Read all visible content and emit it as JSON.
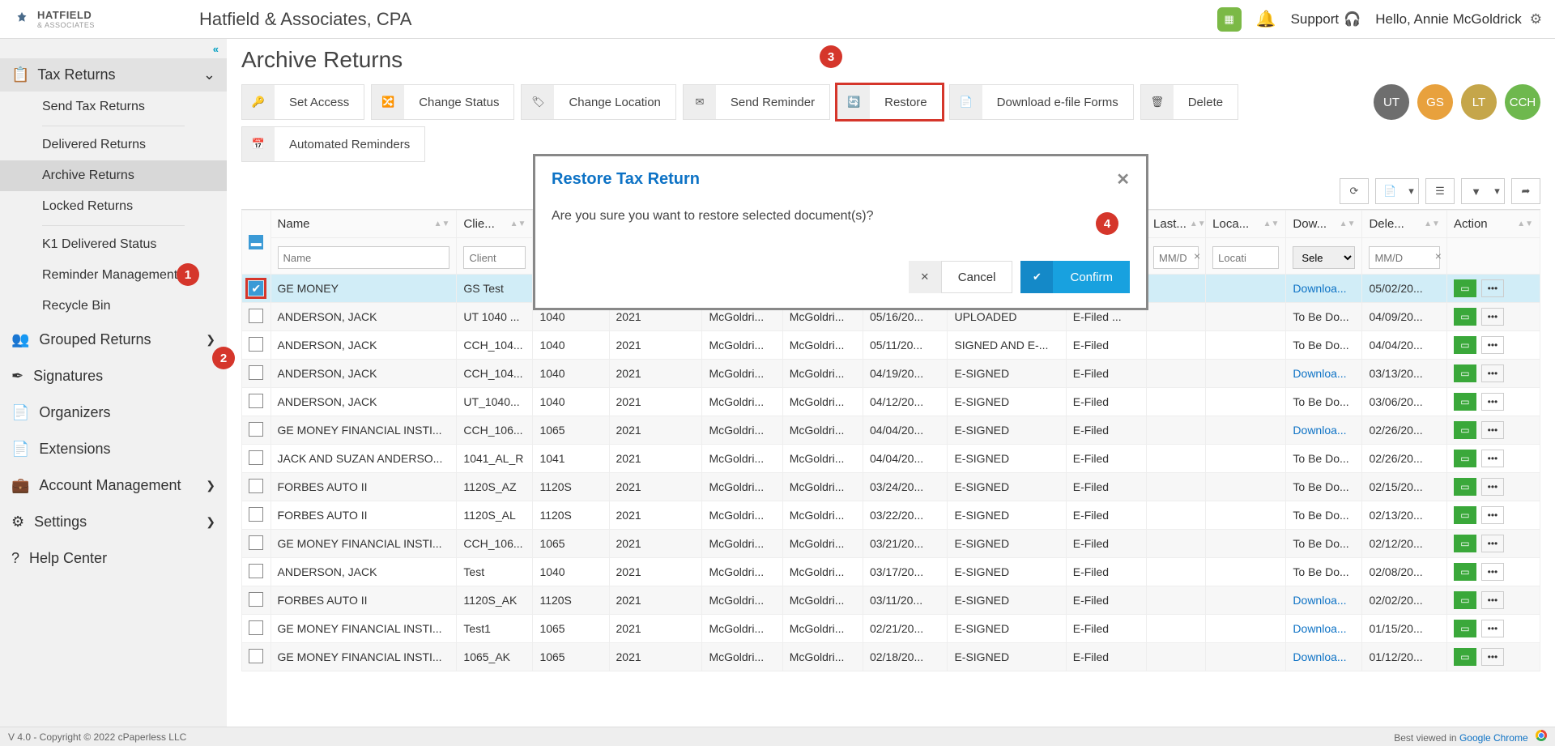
{
  "header": {
    "logo_main": "HATFIELD",
    "logo_sub": "& ASSOCIATES",
    "company": "Hatfield & Associates, CPA",
    "support": "Support",
    "hello": "Hello, Annie McGoldrick"
  },
  "sidebar": {
    "top": "Tax Returns",
    "sub": [
      "Send Tax Returns",
      "Delivered Returns",
      "Archive Returns",
      "Locked Returns",
      "K1 Delivered Status",
      "Reminder Management",
      "Recycle Bin"
    ],
    "selected_index": 2,
    "main": [
      "Grouped Returns",
      "Signatures",
      "Organizers",
      "Extensions",
      "Account Management",
      "Settings",
      "Help Center"
    ],
    "main_has_chev": [
      true,
      false,
      false,
      false,
      true,
      true,
      false
    ]
  },
  "page": {
    "title": "Archive Returns",
    "toolbar": [
      "Set Access",
      "Change Status",
      "Change Location",
      "Send Reminder",
      "Restore",
      "Download e-file Forms",
      "Delete"
    ],
    "toolbar2": [
      "Automated Reminders"
    ],
    "highlight_toolbar_index": 4
  },
  "avatars": [
    {
      "t": "UT",
      "c": "#6e6e6e"
    },
    {
      "t": "GS",
      "c": "#e8a13d"
    },
    {
      "t": "LT",
      "c": "#c5a64a"
    },
    {
      "t": "CCH",
      "c": "#6eb84e"
    }
  ],
  "table": {
    "columns": [
      "Name",
      "Clie...",
      "",
      "",
      "",
      "",
      "",
      "",
      "",
      "Last...",
      "Loca...",
      "Dow...",
      "Dele...",
      "Action"
    ],
    "full_col_hint_idx": [
      0,
      1
    ],
    "filters": {
      "name_ph": "Name",
      "client_ph": "Client",
      "date_ph": "MM/D",
      "loc_ph": "Locati",
      "sel_ph": "Sele"
    },
    "rows": [
      {
        "sel": true,
        "name": "GE MONEY",
        "client": "GS Test",
        "c2": "",
        "c3": "",
        "c4": "",
        "c5": "",
        "c6": "",
        "c7": "",
        "c8": "",
        "last": "",
        "loc": "",
        "dl": "Downloa...",
        "dl_link": true,
        "date": "05/02/20..."
      },
      {
        "name": "ANDERSON, JACK",
        "client": "UT 1040 ...",
        "c2": "1040",
        "c3": "2021",
        "c4": "McGoldri...",
        "c5": "McGoldri...",
        "c6": "05/16/20...",
        "c7": "UPLOADED",
        "c8": "E-Filed ...",
        "last": "",
        "loc": "",
        "dl": "To Be Do...",
        "date": "04/09/20..."
      },
      {
        "name": "ANDERSON, JACK",
        "client": "CCH_104...",
        "c2": "1040",
        "c3": "2021",
        "c4": "McGoldri...",
        "c5": "McGoldri...",
        "c6": "05/11/20...",
        "c7": "SIGNED AND E-...",
        "c8": "E-Filed",
        "last": "",
        "loc": "",
        "dl": "To Be Do...",
        "date": "04/04/20..."
      },
      {
        "name": "ANDERSON, JACK",
        "client": "CCH_104...",
        "c2": "1040",
        "c3": "2021",
        "c4": "McGoldri...",
        "c5": "McGoldri...",
        "c6": "04/19/20...",
        "c7": "E-SIGNED",
        "c8": "E-Filed",
        "last": "",
        "loc": "",
        "dl": "Downloa...",
        "dl_link": true,
        "date": "03/13/20..."
      },
      {
        "name": "ANDERSON, JACK",
        "client": "UT_1040...",
        "c2": "1040",
        "c3": "2021",
        "c4": "McGoldri...",
        "c5": "McGoldri...",
        "c6": "04/12/20...",
        "c7": "E-SIGNED",
        "c8": "E-Filed",
        "last": "",
        "loc": "",
        "dl": "To Be Do...",
        "date": "03/06/20..."
      },
      {
        "name": "GE MONEY FINANCIAL INSTI...",
        "client": "CCH_106...",
        "c2": "1065",
        "c3": "2021",
        "c4": "McGoldri...",
        "c5": "McGoldri...",
        "c6": "04/04/20...",
        "c7": "E-SIGNED",
        "c8": "E-Filed",
        "last": "",
        "loc": "",
        "dl": "Downloa...",
        "dl_link": true,
        "date": "02/26/20..."
      },
      {
        "name": "JACK AND SUZAN ANDERSO...",
        "client": "1041_AL_R",
        "c2": "1041",
        "c3": "2021",
        "c4": "McGoldri...",
        "c5": "McGoldri...",
        "c6": "04/04/20...",
        "c7": "E-SIGNED",
        "c8": "E-Filed",
        "last": "",
        "loc": "",
        "dl": "To Be Do...",
        "date": "02/26/20..."
      },
      {
        "name": "FORBES AUTO II",
        "client": "1120S_AZ",
        "c2": "1120S",
        "c3": "2021",
        "c4": "McGoldri...",
        "c5": "McGoldri...",
        "c6": "03/24/20...",
        "c7": "E-SIGNED",
        "c8": "E-Filed",
        "last": "",
        "loc": "",
        "dl": "To Be Do...",
        "date": "02/15/20..."
      },
      {
        "name": "FORBES AUTO II",
        "client": "1120S_AL",
        "c2": "1120S",
        "c3": "2021",
        "c4": "McGoldri...",
        "c5": "McGoldri...",
        "c6": "03/22/20...",
        "c7": "E-SIGNED",
        "c8": "E-Filed",
        "last": "",
        "loc": "",
        "dl": "To Be Do...",
        "date": "02/13/20..."
      },
      {
        "name": "GE MONEY FINANCIAL INSTI...",
        "client": "CCH_106...",
        "c2": "1065",
        "c3": "2021",
        "c4": "McGoldri...",
        "c5": "McGoldri...",
        "c6": "03/21/20...",
        "c7": "E-SIGNED",
        "c8": "E-Filed",
        "last": "",
        "loc": "",
        "dl": "To Be Do...",
        "date": "02/12/20..."
      },
      {
        "name": "ANDERSON, JACK",
        "client": "Test",
        "c2": "1040",
        "c3": "2021",
        "c4": "McGoldri...",
        "c5": "McGoldri...",
        "c6": "03/17/20...",
        "c7": "E-SIGNED",
        "c8": "E-Filed",
        "last": "",
        "loc": "",
        "dl": "To Be Do...",
        "date": "02/08/20..."
      },
      {
        "name": "FORBES AUTO II",
        "client": "1120S_AK",
        "c2": "1120S",
        "c3": "2021",
        "c4": "McGoldri...",
        "c5": "McGoldri...",
        "c6": "03/11/20...",
        "c7": "E-SIGNED",
        "c8": "E-Filed",
        "last": "",
        "loc": "",
        "dl": "Downloa...",
        "dl_link": true,
        "date": "02/02/20..."
      },
      {
        "name": "GE MONEY FINANCIAL INSTI...",
        "client": "Test1",
        "c2": "1065",
        "c3": "2021",
        "c4": "McGoldri...",
        "c5": "McGoldri...",
        "c6": "02/21/20...",
        "c7": "E-SIGNED",
        "c8": "E-Filed",
        "last": "",
        "loc": "",
        "dl": "Downloa...",
        "dl_link": true,
        "date": "01/15/20..."
      },
      {
        "name": "GE MONEY FINANCIAL INSTI...",
        "client": "1065_AK",
        "c2": "1065",
        "c3": "2021",
        "c4": "McGoldri...",
        "c5": "McGoldri...",
        "c6": "02/18/20...",
        "c7": "E-SIGNED",
        "c8": "E-Filed",
        "last": "",
        "loc": "",
        "dl": "Downloa...",
        "dl_link": true,
        "date": "01/12/20..."
      }
    ]
  },
  "modal": {
    "title": "Restore Tax Return",
    "body": "Are you sure you want to restore selected document(s)?",
    "cancel": "Cancel",
    "confirm": "Confirm"
  },
  "badges": {
    "b1": "1",
    "b2": "2",
    "b3": "3",
    "b4": "4"
  },
  "footer": {
    "left": "V 4.0 - Copyright © 2022 cPaperless LLC",
    "right_prefix": "Best viewed in ",
    "right_link": "Google Chrome"
  },
  "toolbar_icons": [
    "🔑",
    "🔀",
    "🏷",
    "✉",
    "🔄",
    "📄",
    "🗑"
  ],
  "toolbar2_icons": [
    "📅"
  ],
  "side_main_icons": [
    "👥",
    "✒",
    "📄",
    "📄",
    "💼",
    "⚙",
    "?"
  ]
}
